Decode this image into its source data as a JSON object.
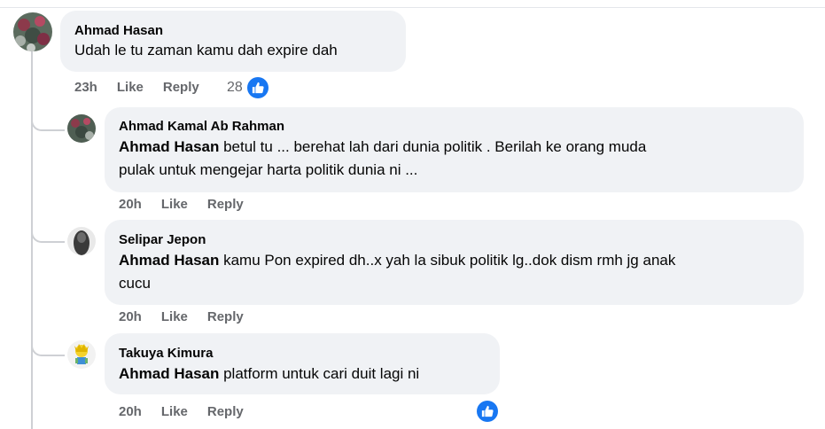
{
  "comments": [
    {
      "author": "Ahmad Hasan",
      "text": "Udah le tu zaman kamu dah expire dah",
      "time": "23h",
      "like_label": "Like",
      "reply_label": "Reply",
      "reaction_count": "28"
    }
  ],
  "replies": [
    {
      "author": "Ahmad Kamal Ab Rahman",
      "mention": "Ahmad Hasan",
      "text_line1": " betul tu ... berehat lah dari dunia politik . Berilah ke orang muda",
      "text_line2": "pulak untuk mengejar harta politik dunia ni ...",
      "time": "20h",
      "like_label": "Like",
      "reply_label": "Reply"
    },
    {
      "author": "Selipar Jepon",
      "mention": "Ahmad Hasan",
      "text_line1": " kamu Pon expired dh..x yah la sibuk politik lg..dok dism rmh jg anak",
      "text_line2": "cucu",
      "time": "20h",
      "like_label": "Like",
      "reply_label": "Reply"
    },
    {
      "author": "Takuya Kimura",
      "mention": "Ahmad Hasan",
      "text_line1": " platform untuk cari duit lagi ni",
      "time": "20h",
      "like_label": "Like",
      "reply_label": "Reply"
    }
  ],
  "colors": {
    "bubble": "#f0f2f5",
    "meta_text": "#65676b",
    "like_blue": "#1877f2",
    "thread_line": "#ced0d4"
  }
}
